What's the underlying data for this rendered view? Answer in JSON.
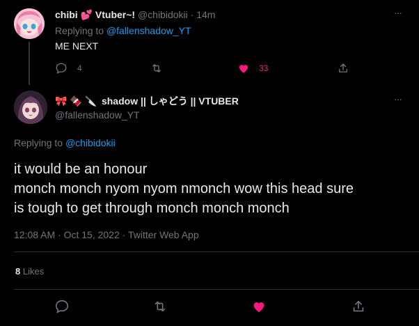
{
  "reply_tweet": {
    "display_name": "chibi",
    "name_emoji": "💕",
    "display_name_suffix": "Vtuber~!",
    "handle": "@chibidokii",
    "separator": "·",
    "time": "14m",
    "more": "···",
    "replying_prefix": "Replying to",
    "replying_handle": "@fallenshadow_YT",
    "text": "ME NEXT",
    "actions": {
      "reply_count": "4",
      "retweet_count": "",
      "like_count": "33",
      "liked": true
    }
  },
  "main_tweet": {
    "name_emojis": "🎀 🍫 🔪",
    "display_name": "shadow || しゃどう || VTUBER",
    "handle": "@fallenshadow_YT",
    "more": "···",
    "replying_prefix": "Replying to",
    "replying_handle": "@chibidokii",
    "text_line1": "it would be an honour",
    "text_line2": "monch monch nyom nyom nmonch wow this head sure",
    "text_line3": "is tough to get through monch monch monch",
    "timestamp": "12:08 AM · Oct 15, 2022 · Twitter Web App",
    "likes_count": "8",
    "likes_label": "Likes",
    "liked": true
  },
  "icons": {
    "reply": "reply-icon",
    "retweet": "retweet-icon",
    "like": "heart-icon",
    "share": "share-icon",
    "more": "more-icon"
  },
  "colors": {
    "background": "#000000",
    "text": "#e7e9ea",
    "muted": "#71767b",
    "link": "#1d9bf0",
    "like": "#f91880",
    "divider": "#2f3336"
  }
}
